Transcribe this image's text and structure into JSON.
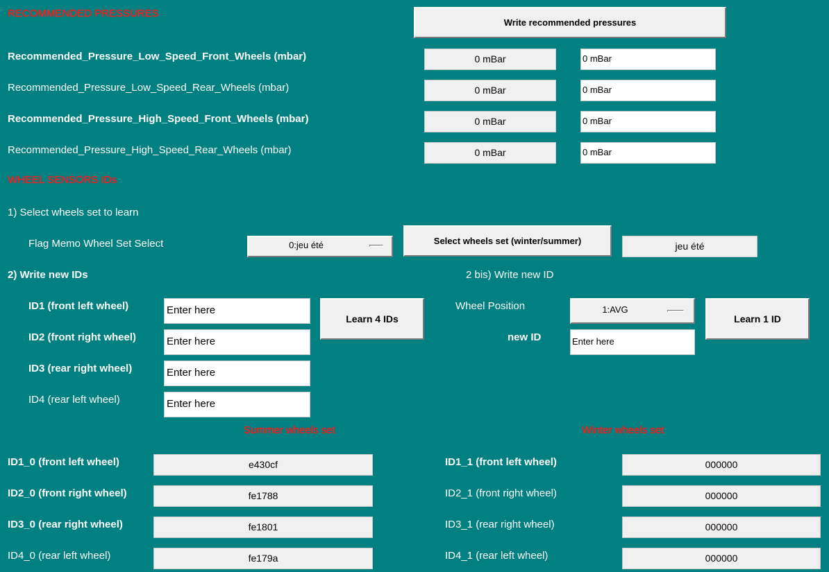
{
  "pressures": {
    "section_title": "RECOMMENDED PRESSURES",
    "write_button": "Write recommended pressures",
    "rows": [
      {
        "label": "Recommended_Pressure_Low_Speed_Front_Wheels (mbar)",
        "value": "0 mBar",
        "input": "0 mBar"
      },
      {
        "label": "Recommended_Pressure_Low_Speed_Rear_Wheels (mbar)",
        "value": "0 mBar",
        "input": "0 mBar"
      },
      {
        "label": "Recommended_Pressure_High_Speed_Front_Wheels (mbar)",
        "value": "0 mBar",
        "input": "0 mBar"
      },
      {
        "label": "Recommended_Pressure_High_Speed_Rear_Wheels (mbar)",
        "value": "0 mBar",
        "input": "0 mBar"
      }
    ]
  },
  "sensors": {
    "section_title": "WHEEL SENSORS IDs",
    "step1": "1) Select wheels set to learn",
    "flag_label": "Flag Memo Wheel Set Select",
    "flag_value": "0:jeu été",
    "select_button": "Select wheels set (winter/summer)",
    "selected_set": "jeu été",
    "step2": "2) Write new IDs",
    "step2bis": "2 bis) Write new ID",
    "id_inputs": [
      {
        "label": "ID1 (front left wheel)",
        "value": "Enter here"
      },
      {
        "label": "ID2 (front right wheel)",
        "value": "Enter here"
      },
      {
        "label": "ID3 (rear right wheel)",
        "value": "Enter here"
      },
      {
        "label": "ID4 (rear left wheel)",
        "value": "Enter here"
      }
    ],
    "learn4_button": "Learn 4 IDs",
    "wheel_position_label": "Wheel Position",
    "wheel_position_value": "1:AVG",
    "new_id_label": "new ID",
    "new_id_value": "Enter here",
    "learn1_button": "Learn 1 ID"
  },
  "summer": {
    "title": "Summer wheels set",
    "rows": [
      {
        "label": "ID1_0 (front left wheel)",
        "value": "e430cf"
      },
      {
        "label": "ID2_0 (front right wheel)",
        "value": "fe1788"
      },
      {
        "label": "ID3_0 (rear right wheel)",
        "value": "fe1801"
      },
      {
        "label": "ID4_0 (rear left wheel)",
        "value": "fe179a"
      }
    ]
  },
  "winter": {
    "title": "Winter wheels set",
    "rows": [
      {
        "label": "ID1_1 (front left wheel)",
        "value": "000000"
      },
      {
        "label": "ID2_1 (front right wheel)",
        "value": "000000"
      },
      {
        "label": "ID3_1 (rear right wheel)",
        "value": "000000"
      },
      {
        "label": "ID4_1 (rear left wheel)",
        "value": "000000"
      }
    ]
  },
  "colors": {
    "background": "#008080",
    "section_title": "#ff2020",
    "field": "#f0f0f0"
  }
}
